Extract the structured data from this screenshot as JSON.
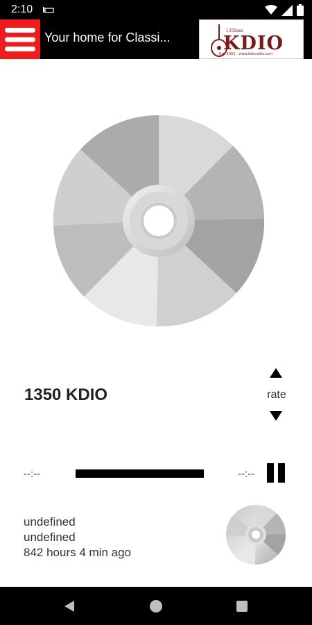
{
  "status_bar": {
    "time": "2:10",
    "icons": [
      "wifi-icon",
      "signal-icon",
      "battery-icon"
    ]
  },
  "app_bar": {
    "title": "Your home for Classi...",
    "menu_icon": "hamburger-menu-icon",
    "logo": {
      "name": "KDIO",
      "tagline": "1350am",
      "footer": "Est. 1951 · www.kdioradio.com"
    },
    "accent_color": "#ee1c1c"
  },
  "player": {
    "station": "1350 KDIO",
    "rate_label": "rate",
    "time_elapsed": "--:--",
    "time_remaining": "--:--",
    "state": "playing",
    "progress": 0
  },
  "track": {
    "line1": "undefined",
    "line2": "undefined",
    "line3": "842 hours 4 min ago"
  }
}
